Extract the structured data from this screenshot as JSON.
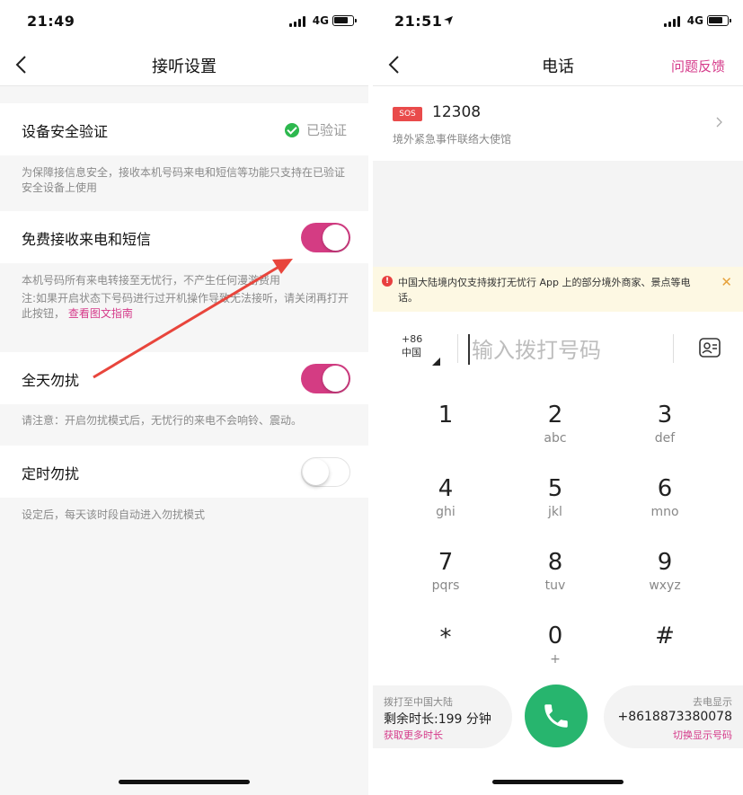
{
  "left_screen": {
    "status": {
      "time": "21:49",
      "network": "4G"
    },
    "nav": {
      "title": "接听设置"
    },
    "device_verify": {
      "label": "设备安全验证",
      "status": "已验证"
    },
    "verify_note": "为保障接信息安全，接收本机号码来电和短信等功能只支持在已验证安全设备上使用",
    "free_receive": {
      "label": "免费接收来电和短信",
      "on": true
    },
    "free_receive_note": {
      "line1": "本机号码所有来电转接至无忧行，不产生任何漫游费用",
      "line2": "注:如果开启状态下号码进行过开机操作导致无法接听，请关闭再打开此按钮，",
      "link": "查看图文指南"
    },
    "dnd_all_day": {
      "label": "全天勿扰",
      "on": true
    },
    "dnd_note": "请注意：开启勿扰模式后，无忧行的来电不会响铃、震动。",
    "dnd_scheduled": {
      "label": "定时勿扰",
      "on": false
    },
    "scheduled_note": "设定后，每天该时段自动进入勿扰模式"
  },
  "right_screen": {
    "status": {
      "time": "21:51",
      "network": "4G"
    },
    "nav": {
      "title": "电话",
      "feedback": "问题反馈"
    },
    "sos": {
      "badge": "SOS",
      "number": "12308",
      "desc": "境外紧急事件联络大使馆"
    },
    "warning": "中国大陆境内仅支持拨打无忧行 App 上的部分境外商家、景点等电话。",
    "dial": {
      "code": "+86",
      "region": "中国",
      "placeholder": "输入拨打号码"
    },
    "keypad": [
      {
        "digit": "1",
        "letters": ""
      },
      {
        "digit": "2",
        "letters": "abc"
      },
      {
        "digit": "3",
        "letters": "def"
      },
      {
        "digit": "4",
        "letters": "ghi"
      },
      {
        "digit": "5",
        "letters": "jkl"
      },
      {
        "digit": "6",
        "letters": "mno"
      },
      {
        "digit": "7",
        "letters": "pqrs"
      },
      {
        "digit": "8",
        "letters": "tuv"
      },
      {
        "digit": "9",
        "letters": "wxyz"
      },
      {
        "digit": "*",
        "letters": ""
      },
      {
        "digit": "0",
        "letters": "+"
      },
      {
        "digit": "#",
        "letters": ""
      }
    ],
    "left_pill": {
      "title": "拨打至中国大陆",
      "remaining": "剩余时长:199 分钟",
      "link": "获取更多时长"
    },
    "right_pill": {
      "title": "去电显示",
      "number": "+8618873380078",
      "link": "切换显示号码"
    }
  },
  "colors": {
    "accent": "#d43c83",
    "call_green": "#27b56e",
    "verified_green": "#2db84e",
    "annotation_arrow": "#e8453c"
  }
}
